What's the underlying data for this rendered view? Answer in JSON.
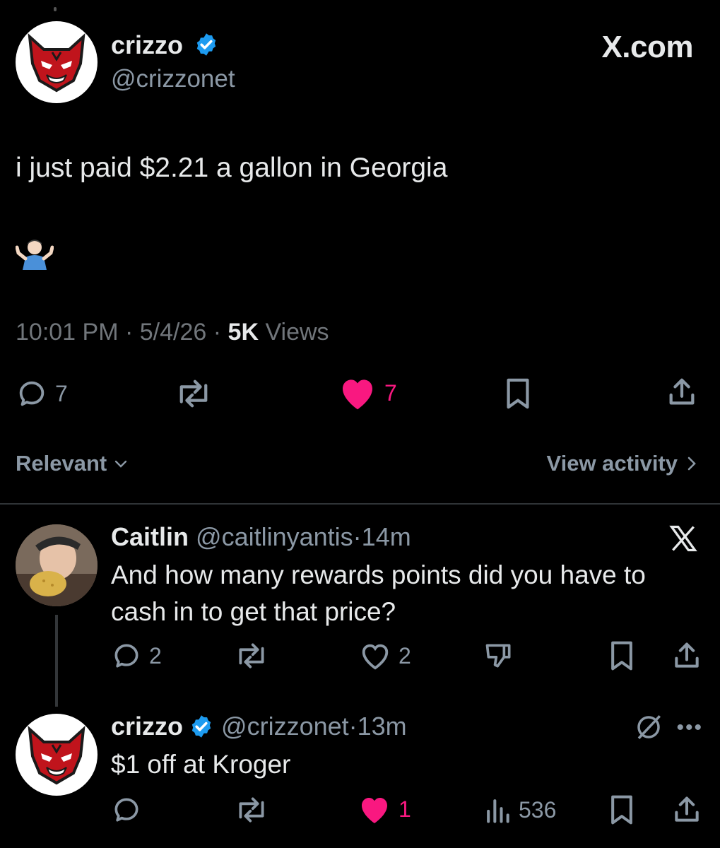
{
  "brand": "X.com",
  "main_tweet": {
    "author_name": "crizzo",
    "handle": "@crizzonet",
    "text": "i just paid $2.21 a gallon in Georgia",
    "emoji": "🤷🏻‍♂️",
    "time": "10:01 PM",
    "date": "5/4/26",
    "views_count": "5K",
    "views_label": "Views",
    "replies": "7",
    "likes": "7"
  },
  "sort": {
    "label": "Relevant"
  },
  "activity": {
    "label": "View activity"
  },
  "reply1": {
    "name": "Caitlin",
    "handle": "@caitlinyantis",
    "sep": "·",
    "age": "14m",
    "text": "And how many rewards points did you have to cash in to get that price?",
    "replies": "2",
    "likes": "2"
  },
  "reply2": {
    "name": "crizzo",
    "handle": "@crizzonet",
    "sep": "·",
    "age": "13m",
    "text": "$1 off at Kroger",
    "likes": "1",
    "views": "536"
  },
  "colors": {
    "background": "#000000",
    "text": "#e7e9ea",
    "muted": "#71767b",
    "like": "#f91880",
    "verified": "#1d9bf0"
  }
}
